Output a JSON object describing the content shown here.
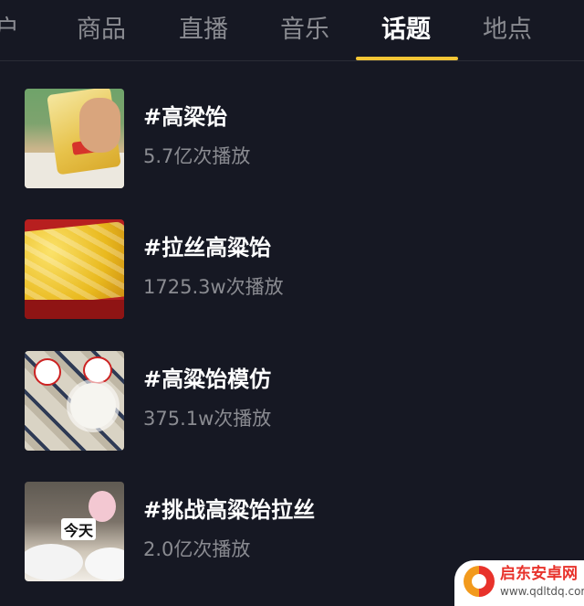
{
  "tabs": [
    {
      "label": "户",
      "active": false
    },
    {
      "label": "商品",
      "active": false
    },
    {
      "label": "直播",
      "active": false
    },
    {
      "label": "音乐",
      "active": false
    },
    {
      "label": "话题",
      "active": true
    },
    {
      "label": "地点",
      "active": false
    }
  ],
  "colors": {
    "background": "#161823",
    "accent": "#f4c535",
    "text_primary": "#ffffff",
    "text_secondary": "#8a8b91"
  },
  "topics": [
    {
      "title": "#高梁饴",
      "plays": "5.7亿次播放"
    },
    {
      "title": "#拉丝高粱饴",
      "plays": "1725.3w次播放"
    },
    {
      "title": "#高粱饴模仿",
      "plays": "375.1w次播放"
    },
    {
      "title": "#挑战高粱饴拉丝",
      "plays": "2.0亿次播放",
      "thumb_caption": "今天"
    }
  ],
  "watermark": {
    "name": "启东安卓网",
    "url": "www.qdltdq.com",
    "icon": "qidong-logo-icon"
  }
}
